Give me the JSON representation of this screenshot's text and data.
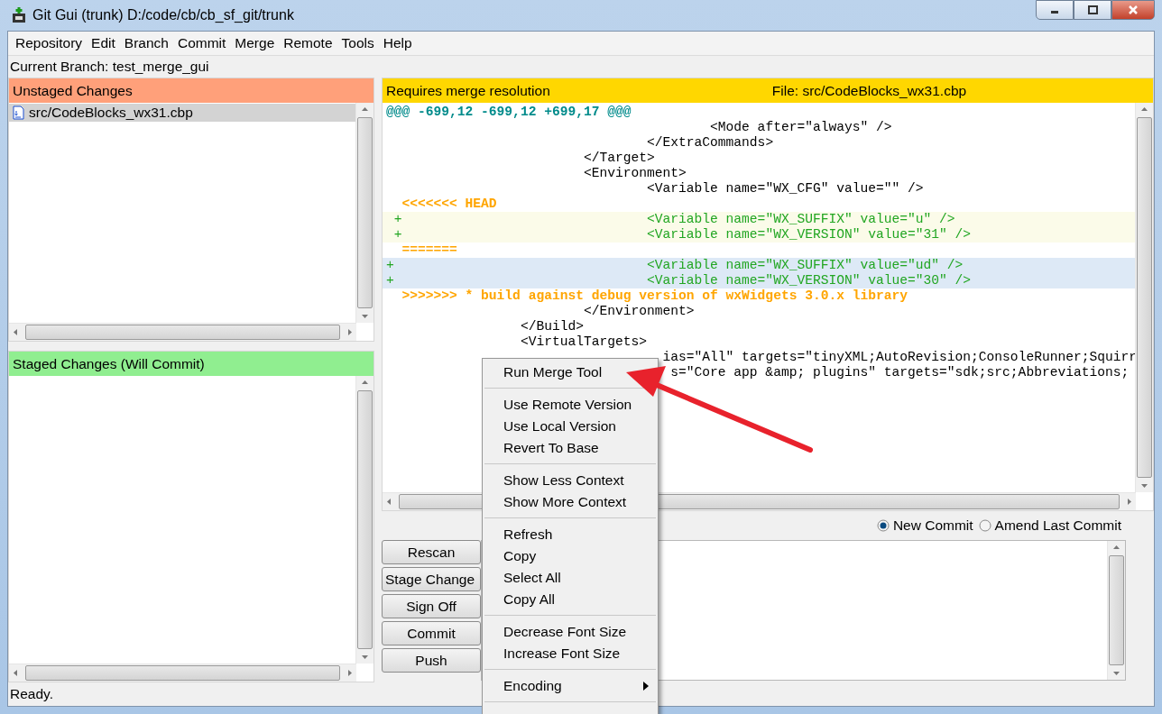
{
  "window": {
    "title": "Git Gui (trunk) D:/code/cb/cb_sf_git/trunk"
  },
  "menu_bar": [
    "Repository",
    "Edit",
    "Branch",
    "Commit",
    "Merge",
    "Remote",
    "Tools",
    "Help"
  ],
  "current_branch": "Current Branch: test_merge_gui",
  "unstaged": {
    "title": "Unstaged Changes",
    "files": [
      {
        "name": "src/CodeBlocks_wx31.cbp",
        "selected": true
      }
    ]
  },
  "staged": {
    "title": "Staged Changes (Will Commit)"
  },
  "diff": {
    "status": "Requires merge resolution",
    "file": "File:  src/CodeBlocks_wx31.cbp",
    "lines": [
      {
        "kind": "hunk",
        "text": "@@@ -699,12 -699,12 +699,17 @@@"
      },
      {
        "kind": "context",
        "text": "                                         <Mode after=\"always\" />"
      },
      {
        "kind": "context",
        "text": "                                 </ExtraCommands>"
      },
      {
        "kind": "context",
        "text": "                         </Target>"
      },
      {
        "kind": "context",
        "text": "                         <Environment>"
      },
      {
        "kind": "context",
        "text": "                                 <Variable name=\"WX_CFG\" value=\"\" />"
      },
      {
        "kind": "marker",
        "text": "  <<<<<<< HEAD"
      },
      {
        "kind": "ours",
        "text": " +                               <Variable name=\"WX_SUFFIX\" value=\"u\" />"
      },
      {
        "kind": "ours",
        "text": " +                               <Variable name=\"WX_VERSION\" value=\"31\" />"
      },
      {
        "kind": "marker",
        "text": "  ======="
      },
      {
        "kind": "theirs",
        "text": "+                                <Variable name=\"WX_SUFFIX\" value=\"ud\" />"
      },
      {
        "kind": "theirs",
        "text": "+                                <Variable name=\"WX_VERSION\" value=\"30\" />"
      },
      {
        "kind": "marker",
        "text": "  >>>>>>> * build against debug version of wxWidgets 3.0.x library"
      },
      {
        "kind": "context",
        "text": "                         </Environment>"
      },
      {
        "kind": "context",
        "text": "                 </Build>"
      },
      {
        "kind": "context",
        "text": "                 <VirtualTargets>"
      },
      {
        "kind": "context",
        "text": "                                   ias=\"All\" targets=\"tinyXML;AutoRevision;ConsoleRunner;Squirr"
      },
      {
        "kind": "context",
        "text": "                                    s=\"Core app &amp; plugins\" targets=\"sdk;src;Abbreviations;"
      }
    ]
  },
  "commit": {
    "options": [
      {
        "label": "New Commit",
        "selected": true
      },
      {
        "label": "Amend Last Commit",
        "selected": false
      }
    ],
    "buttons": [
      "Rescan",
      "Stage Change",
      "Sign Off",
      "Commit",
      "Push"
    ]
  },
  "context_menu": {
    "groups": [
      [
        {
          "label": "Run Merge Tool",
          "submenu": false
        }
      ],
      [
        {
          "label": "Use Remote Version",
          "submenu": false
        },
        {
          "label": "Use Local Version",
          "submenu": false
        },
        {
          "label": "Revert To Base",
          "submenu": false
        }
      ],
      [
        {
          "label": "Show Less Context",
          "submenu": false
        },
        {
          "label": "Show More Context",
          "submenu": false
        }
      ],
      [
        {
          "label": "Refresh",
          "submenu": false
        },
        {
          "label": "Copy",
          "submenu": false
        },
        {
          "label": "Select All",
          "submenu": false
        },
        {
          "label": "Copy All",
          "submenu": false
        }
      ],
      [
        {
          "label": "Decrease Font Size",
          "submenu": false
        },
        {
          "label": "Increase Font Size",
          "submenu": false
        }
      ],
      [
        {
          "label": "Encoding",
          "submenu": true
        }
      ]
    ]
  },
  "status_bar": "Ready."
}
